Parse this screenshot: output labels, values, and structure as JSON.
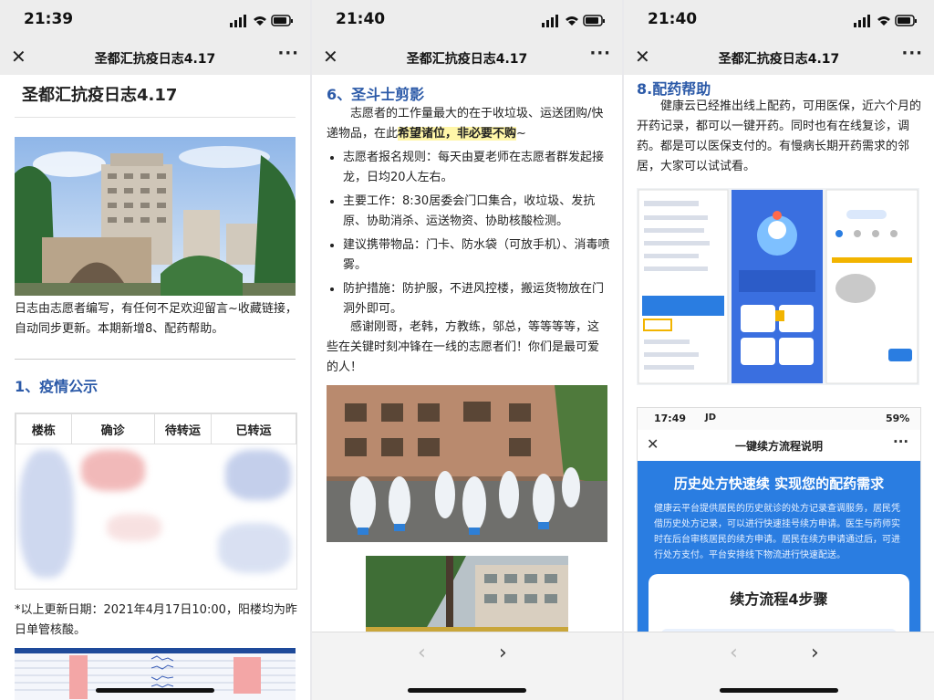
{
  "status": {
    "times": [
      "21:39",
      "21:40",
      "21:40"
    ]
  },
  "header": {
    "title": "圣都汇抗疫日志4.17"
  },
  "screen1": {
    "heading": "圣都汇抗疫日志4.17",
    "intro": "日志由志愿者编写，有任何不足欢迎留言~收藏链接，自动同步更新。本期新增8、配药帮助。",
    "section_title": "1、疫情公示",
    "table_headers": [
      "楼栋",
      "确诊",
      "待转运",
      "已转运"
    ],
    "footnote": "*以上更新日期：2021年4月17日10:00，阳楼均为昨日单管核酸。"
  },
  "screen2": {
    "section_title": "6、圣斗士剪影",
    "para1_a": "志愿者的工作量最大的在于收垃圾、运送团购/快递物品，在此",
    "para1_hl": "希望诸位，非必要不购",
    "para1_b": "~",
    "bullets": [
      "志愿者报名规则：每天由夏老师在志愿者群发起接龙，日均20人左右。",
      "主要工作：8:30居委会门口集合，收垃圾、发抗原、协助消杀、运送物资、协助核酸检测。",
      "建议携带物品：门卡、防水袋（可放手机）、消毒喷雾。",
      "防护措施：防护服，不进风控楼，搬运货物放在门洞外即可。"
    ],
    "thanks": "感谢刚哥，老韩，方教练，邬总，等等等等，这些在关键时刻冲锋在一线的志愿者们！你们是最可爱的人！"
  },
  "screen3": {
    "section_title": "8.配药帮助",
    "para": "健康云已经推出线上配药，可用医保，近六个月的开药记录，都可以一键开药。同时也有在线复诊，调药。都是可以医保支付的。有慢病长期开药需求的邻居，大家可以试试看。",
    "shot_status_time": "17:49",
    "shot_status_extra": "JD",
    "shot_battery": "59%",
    "shot_title": "一键续方流程说明",
    "banner_title": "历史处方快速续 实现您的配药需求",
    "banner_text": "健康云平台提供居民的历史就诊的处方记录查调服务，居民凭借历史处方记录，可以进行快速挂号续方申请。医生与药师实时在后台审核居民的续方申请。居民在续方申请通过后，可进行处方支付。平台安排线下物流进行快速配送。",
    "steps_title": "续方流程4步骤"
  },
  "icons": {
    "close": "close-icon",
    "more": "more-icon",
    "back": "chevron-left-icon",
    "forward": "chevron-right-icon"
  },
  "colors": {
    "accent_blue": "#2c5aa8",
    "highlight": "#fff6a8",
    "app_blue": "#2a7de1"
  }
}
